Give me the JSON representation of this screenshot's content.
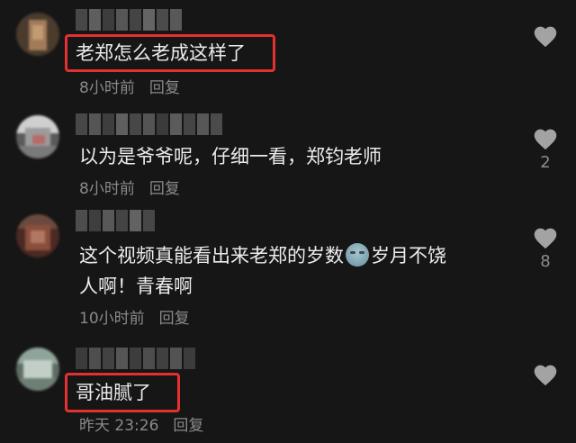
{
  "comments": [
    {
      "text_lines": [
        "老郑怎么老成这样了"
      ],
      "time": "8小时前",
      "reply_label": "回复",
      "likes": "",
      "highlighted": true
    },
    {
      "text_lines": [
        "以为是爷爷呢，仔细一看，郑钧老师"
      ],
      "time": "8小时前",
      "reply_label": "回复",
      "likes": "2",
      "highlighted": false
    },
    {
      "text_lines": [
        "这个视频真能看出来老郑的岁数",
        "岁月不饶",
        "人啊！青春啊"
      ],
      "emoji": "cold-sweat-emoji",
      "time": "10小时前",
      "reply_label": "回复",
      "likes": "8",
      "highlighted": false
    },
    {
      "text_lines": [
        "哥油腻了"
      ],
      "time": "昨天 23:26",
      "reply_label": "回复",
      "likes": "",
      "highlighted": true
    }
  ],
  "colors": {
    "background": "#161616",
    "text": "#ececec",
    "meta": "#8a8a8a",
    "like_icon": "#a3a3a3",
    "highlight_box": "#e53030"
  },
  "icons": [
    "heart-icon"
  ]
}
